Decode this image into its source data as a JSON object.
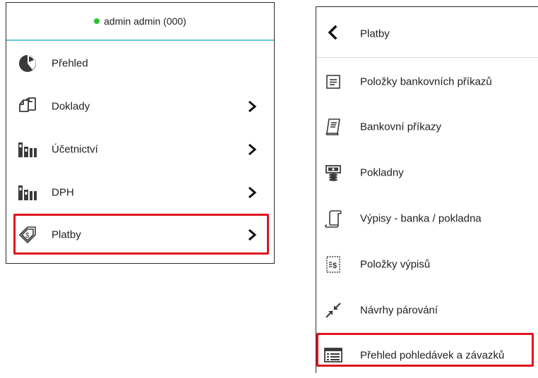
{
  "left_menu": {
    "user_status": "admin admin (000)",
    "items": [
      {
        "label": "Přehled",
        "icon": "pie-chart-icon",
        "has_submenu": false
      },
      {
        "label": "Doklady",
        "icon": "documents-icon",
        "has_submenu": true
      },
      {
        "label": "Účetnictví",
        "icon": "books-icon",
        "has_submenu": true
      },
      {
        "label": "DPH",
        "icon": "books-icon",
        "has_submenu": true
      },
      {
        "label": "Platby",
        "icon": "payment-tag-icon",
        "has_submenu": true,
        "highlighted": true
      }
    ]
  },
  "right_menu": {
    "back_label": "Platby",
    "items": [
      {
        "label": "Položky bankovních příkazů",
        "icon": "list-document-icon"
      },
      {
        "label": "Bankovní příkazy",
        "icon": "receipt-icon"
      },
      {
        "label": "Pokladny",
        "icon": "cash-register-icon"
      },
      {
        "label": "Výpisy - banka / pokladna",
        "icon": "scroll-icon"
      },
      {
        "label": "Položky výpisů",
        "icon": "statement-dollar-icon"
      },
      {
        "label": "Návrhy párování",
        "icon": "pairing-arrows-icon"
      },
      {
        "label": "Přehled pohledávek a závazků",
        "icon": "table-list-icon",
        "highlighted": true
      }
    ]
  },
  "colors": {
    "online_status": "#2ec02e",
    "header_underline": "#66c8d9",
    "highlight_border": "#e0141e",
    "icon": "#3a3a3a"
  }
}
